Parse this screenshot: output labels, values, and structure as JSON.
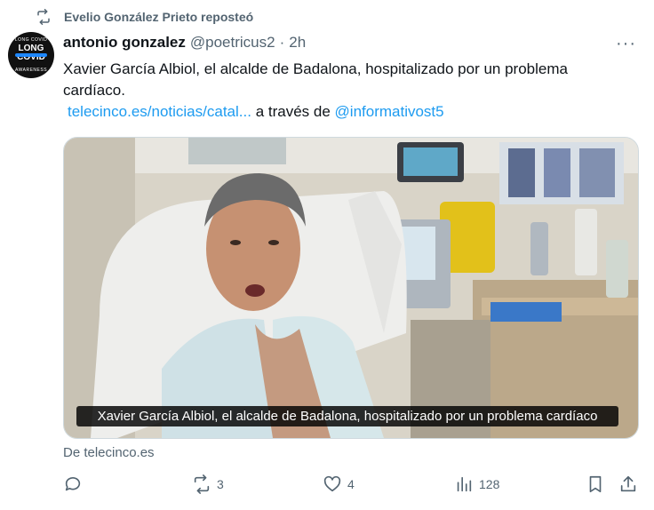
{
  "repost": {
    "label": "Evelio González Prieto reposteó"
  },
  "avatar": {
    "top_text": "LONG COVID",
    "main_text": "LONG COVID",
    "bottom_text": "AWARENESS"
  },
  "tweet": {
    "name": "antonio gonzalez",
    "handle": "@poetricus2",
    "dot": "·",
    "time": "2h",
    "more": "···",
    "text": "Xavier García Albiol, el alcalde de Badalona, hospitalizado por un problema cardíaco.",
    "link": "telecinco.es/noticias/catal...",
    "via_text": "a través de",
    "via_handle": "@informativost5"
  },
  "media": {
    "caption": "Xavier García Albiol, el alcalde de Badalona, hospitalizado por un problema cardíaco"
  },
  "source": "De telecinco.es",
  "actions": {
    "reply": "",
    "retweets": "3",
    "likes": "4",
    "views": "128"
  },
  "colors": {
    "link": "#1d9bf0",
    "muted": "#536471",
    "text": "#0f1419"
  }
}
